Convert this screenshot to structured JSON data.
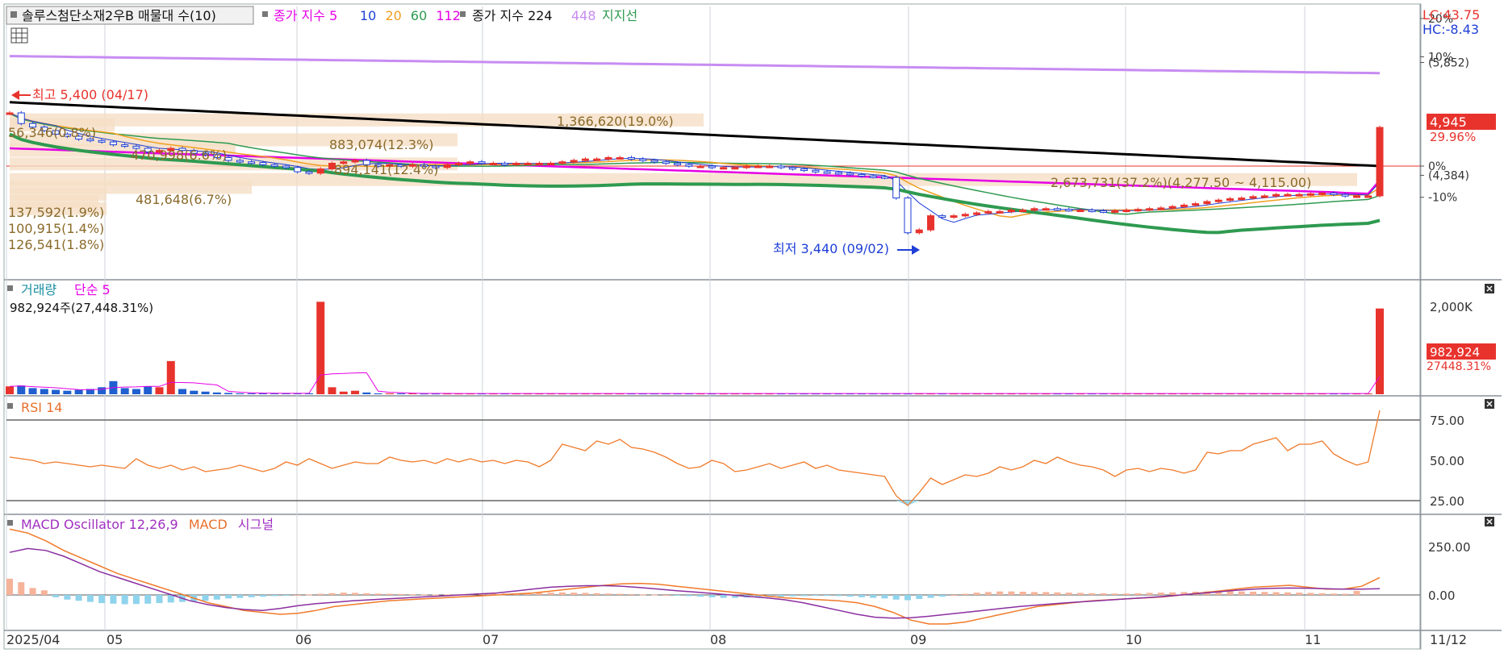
{
  "header": {
    "menu_icon": "square-icon",
    "stock_name": "솔루스첨단소재2우B 매물대 수(10)",
    "ma_label": "종가 지수",
    "ma_periods": [
      "5",
      "10",
      "20",
      "60",
      "112"
    ],
    "ma_colors": [
      "#e600e6",
      "#1f3fd6",
      "#f0a020",
      "#2e9a50",
      "#e600e6"
    ],
    "ma2_label": "종가 지수",
    "ma2_periods": [
      "224",
      "448"
    ],
    "ma2_colors": [
      "#000000",
      "#c78cf2"
    ],
    "support_label": "지지선",
    "grid_icon": "grid-icon"
  },
  "right_info": {
    "lc": "LC:43.75",
    "hc": "HC:-8.43"
  },
  "price_axis": {
    "ticks": [
      {
        "label": "20%",
        "value": 6480
      },
      {
        "label": "10%",
        "value": 5940
      },
      {
        "label": "(5,852)",
        "value": 5860
      },
      {
        "label": "0%",
        "value": 4400
      },
      {
        "label": "(4,384)",
        "value": 4270
      },
      {
        "label": "-10%",
        "value": 3960
      }
    ],
    "current_price": "4,945",
    "current_change": "29.96%",
    "ref_price": 4400
  },
  "annotations": {
    "high": "최고 5,400 (04/17)",
    "low": "최저 3,440 (09/02)"
  },
  "volume_profile": [
    {
      "label": "1,366,620(19.0%)",
      "price": 5050
    },
    {
      "label": "883,074(12.3%)",
      "price": 4770
    },
    {
      "label": "894,141(12.4%)",
      "price": 4430
    },
    {
      "label": "2,673,731(37.2%)(4,277.50 ~ 4,115.00)",
      "price": 4210
    },
    {
      "label": "481,648(6.7%)",
      "price": 4100
    },
    {
      "label": "470,998(6.6%)",
      "price": 4620
    },
    {
      "label": "56,346(0.8%)",
      "price": 4980
    },
    {
      "label": "137,592(1.9%)",
      "price": 4000
    },
    {
      "label": "100,915(1.4%)",
      "price": 3900
    },
    {
      "label": "126,541(1.8%)",
      "price": 3800
    }
  ],
  "volume_panel": {
    "title": "거래량",
    "ma_label": "단순 5",
    "last_value_text": "982,924주(27,448.31%)",
    "axis_tick": "2,000K",
    "current_value": "982,924",
    "current_change": "27448.31%"
  },
  "rsi_panel": {
    "title": "RSI 14",
    "ticks": [
      "75.00",
      "50.00",
      "25.00"
    ]
  },
  "macd_panel": {
    "title": "MACD Oscillator 12,26,9",
    "macd_label": "MACD",
    "signal_label": "시그널",
    "ticks": [
      "250.00",
      "0.00"
    ]
  },
  "x_axis": {
    "labels": [
      "2025/04",
      "05",
      "06",
      "07",
      "08",
      "09",
      "10",
      "11",
      "11/12"
    ]
  },
  "chart_data": {
    "type": "candlestick",
    "price": {
      "start_label": "2025/04",
      "high": 5400,
      "high_date": "04/17",
      "low": 3440,
      "low_date": "09/02",
      "last_close": 4945,
      "closes": [
        5150,
        5000,
        4950,
        4900,
        4850,
        4820,
        4780,
        4760,
        4740,
        4700,
        4680,
        4650,
        4600,
        4620,
        4650,
        4620,
        4580,
        4560,
        4520,
        4480,
        4460,
        4450,
        4420,
        4400,
        4380,
        4320,
        4300,
        4360,
        4440,
        4460,
        4480,
        4420,
        4400,
        4420,
        4400,
        4420,
        4400,
        4380,
        4420,
        4440,
        4460,
        4440,
        4440,
        4420,
        4440,
        4440,
        4440,
        4440,
        4460,
        4480,
        4500,
        4500,
        4520,
        4520,
        4500,
        4480,
        4460,
        4440,
        4420,
        4400,
        4400,
        4380,
        4380,
        4380,
        4400,
        4400,
        4400,
        4380,
        4360,
        4340,
        4320,
        4310,
        4300,
        4280,
        4260,
        4250,
        4240,
        3950,
        3460,
        3500,
        3700,
        3680,
        3700,
        3720,
        3740,
        3760,
        3760,
        3780,
        3780,
        3800,
        3800,
        3790,
        3780,
        3780,
        3770,
        3760,
        3770,
        3780,
        3790,
        3800,
        3810,
        3830,
        3850,
        3870,
        3900,
        3920,
        3940,
        3950,
        3970,
        3980,
        4000,
        4000,
        4000,
        4010,
        4020,
        4000,
        3980,
        3980,
        3980,
        4945
      ]
    },
    "volume": {
      "last": 982924,
      "values": [
        90,
        100,
        70,
        60,
        50,
        40,
        50,
        60,
        80,
        150,
        70,
        60,
        90,
        80,
        380,
        60,
        40,
        30,
        20,
        15,
        10,
        10,
        10,
        10,
        10,
        10,
        10,
        1060,
        80,
        30,
        40,
        20,
        10,
        10,
        10,
        10,
        8,
        8,
        8,
        8,
        8,
        8,
        8,
        8,
        8,
        8,
        8,
        8,
        8,
        8,
        8,
        8,
        8,
        8,
        8,
        8,
        8,
        8,
        8,
        8,
        8,
        8,
        8,
        8,
        8,
        8,
        8,
        8,
        8,
        8,
        8,
        8,
        8,
        8,
        8,
        8,
        8,
        8,
        8,
        8,
        8,
        8,
        8,
        8,
        8,
        8,
        8,
        8,
        8,
        8,
        8,
        8,
        8,
        8,
        8,
        8,
        8,
        8,
        8,
        8,
        8,
        8,
        8,
        8,
        8,
        8,
        8,
        8,
        8,
        8,
        8,
        8,
        8,
        8,
        8,
        8,
        8,
        8,
        8,
        983
      ]
    },
    "rsi": {
      "values": [
        52,
        51,
        50,
        48,
        49,
        48,
        47,
        46,
        47,
        46,
        45,
        51,
        47,
        45,
        47,
        44,
        46,
        43,
        44,
        45,
        47,
        45,
        43,
        45,
        49,
        47,
        51,
        48,
        45,
        47,
        49,
        48,
        48,
        52,
        50,
        49,
        50,
        48,
        51,
        49,
        51,
        49,
        50,
        48,
        50,
        49,
        46,
        50,
        60,
        58,
        56,
        62,
        60,
        63,
        58,
        57,
        55,
        52,
        48,
        45,
        46,
        50,
        48,
        43,
        44,
        46,
        48,
        45,
        47,
        49,
        45,
        47,
        44,
        43,
        42,
        41,
        40,
        28,
        22,
        30,
        39,
        35,
        38,
        41,
        40,
        42,
        46,
        44,
        46,
        50,
        48,
        52,
        49,
        47,
        46,
        44,
        40,
        44,
        45,
        43,
        45,
        44,
        42,
        44,
        55,
        54,
        56,
        56,
        60,
        62,
        64,
        56,
        60,
        60,
        62,
        54,
        50,
        47,
        49,
        81
      ]
    },
    "macd": {
      "oscillator_range": [
        -80,
        140
      ],
      "oscillator": [
        140,
        110,
        60,
        40,
        -20,
        -40,
        -50,
        -60,
        -70,
        -75,
        -80,
        -78,
        -75,
        -70,
        -65,
        -60,
        -55,
        -50,
        -40,
        -30,
        -25,
        -20,
        -15,
        -10,
        -5,
        0,
        5,
        10,
        15,
        20,
        18,
        15,
        12,
        10,
        8,
        6,
        5,
        4,
        4,
        5,
        6,
        8,
        10,
        12,
        14,
        16,
        18,
        20,
        22,
        20,
        18,
        15,
        12,
        10,
        8,
        5,
        2,
        0,
        -5,
        -10,
        -15,
        -20,
        -25,
        -25,
        -22,
        -20,
        -18,
        -15,
        -12,
        -10,
        -8,
        -8,
        -10,
        -15,
        -20,
        -25,
        -30,
        -40,
        -45,
        -35,
        -25,
        -15,
        0,
        10,
        20,
        25,
        30,
        30,
        28,
        25,
        25,
        22,
        20,
        18,
        15,
        14,
        12,
        12,
        15,
        18,
        20,
        22,
        25,
        28,
        30,
        32,
        34,
        30,
        28,
        26,
        24,
        22,
        20,
        18,
        15,
        12,
        10,
        35
      ],
      "macd_line": [
        340,
        320,
        280,
        230,
        190,
        150,
        110,
        80,
        50,
        20,
        -10,
        -40,
        -60,
        -80,
        -90,
        -100,
        -95,
        -80,
        -60,
        -50,
        -40,
        -30,
        -25,
        -20,
        -15,
        -10,
        -5,
        0,
        5,
        10,
        20,
        30,
        40,
        50,
        58,
        60,
        55,
        45,
        35,
        25,
        15,
        5,
        -5,
        -15,
        -20,
        -25,
        -30,
        -40,
        -60,
        -90,
        -130,
        -150,
        -150,
        -140,
        -120,
        -100,
        -80,
        -60,
        -50,
        -40,
        -30,
        -25,
        -20,
        -15,
        -10,
        0,
        10,
        20,
        30,
        40,
        45,
        50,
        40,
        30,
        30,
        45,
        90
      ],
      "signal_line": [
        220,
        240,
        230,
        200,
        160,
        120,
        90,
        60,
        30,
        0,
        -30,
        -50,
        -65,
        -75,
        -80,
        -70,
        -55,
        -45,
        -38,
        -30,
        -25,
        -20,
        -15,
        -10,
        -5,
        0,
        5,
        10,
        20,
        30,
        40,
        45,
        48,
        48,
        45,
        38,
        30,
        22,
        15,
        8,
        0,
        -8,
        -15,
        -25,
        -40,
        -60,
        -80,
        -100,
        -115,
        -120,
        -118,
        -110,
        -100,
        -90,
        -80,
        -70,
        -60,
        -52,
        -45,
        -38,
        -32,
        -26,
        -20,
        -14,
        -8,
        0,
        8,
        16,
        24,
        30,
        34,
        36,
        35,
        32,
        30,
        30,
        32
      ]
    }
  }
}
